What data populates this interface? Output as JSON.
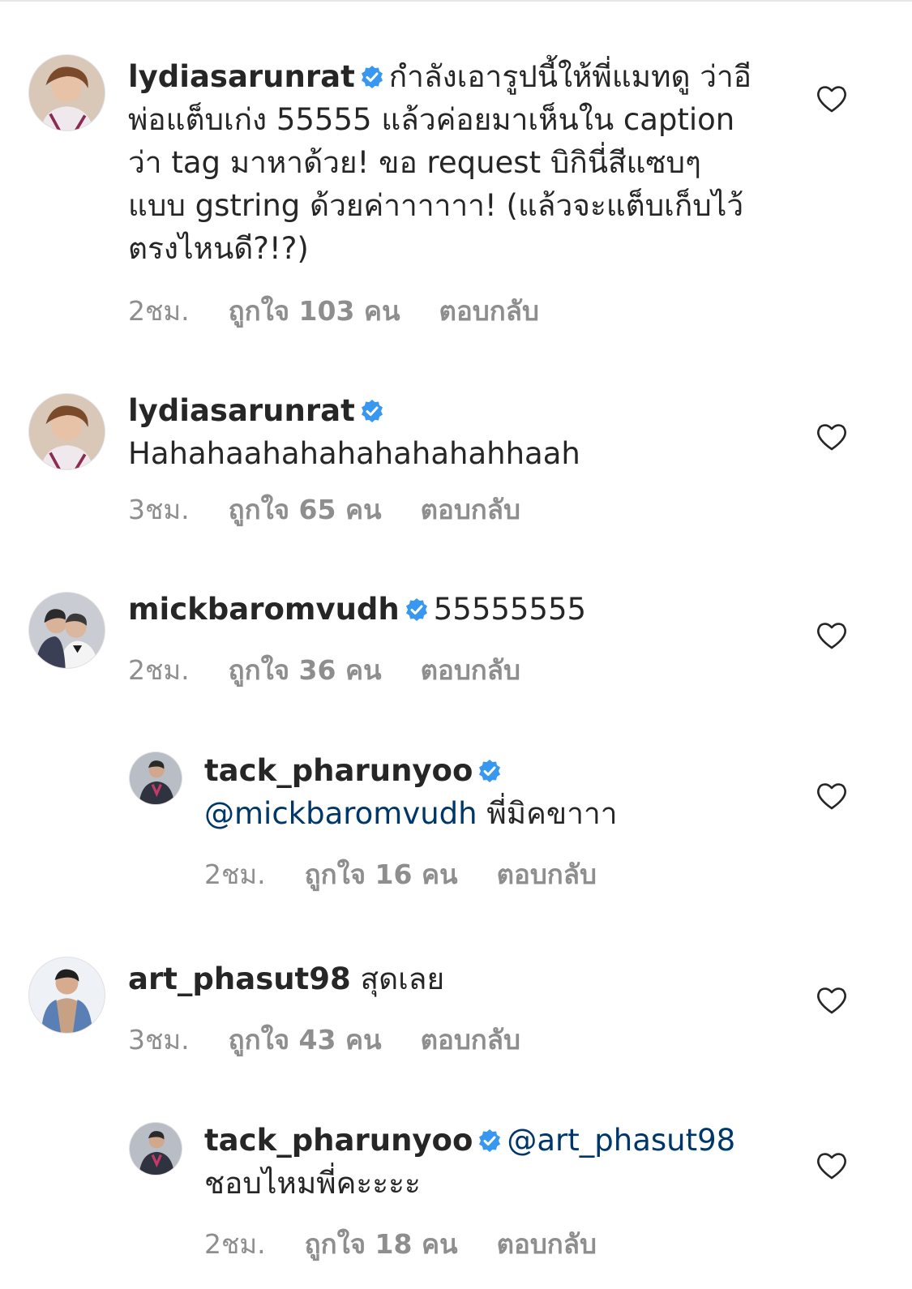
{
  "comments": [
    {
      "username": "lydiasarunrat",
      "verified": true,
      "mention": "",
      "text": "กำลังเอารูปนี้ให้พี่แมทดู ว่าอีพ่อแต็บเก่ง 55555 แล้วค่อยมาเห็นใน caption ว่า tag มาหาด้วย! ขอ request บิกินี่สีแซบๆแบบ gstring ด้วยค่าาาาาา! (แล้วจะแต็บเก็บไว้ตรงไหนดี?!?)",
      "time": "2ชม.",
      "likes": "ถูกใจ 103 คน",
      "reply_label": "ตอบกลับ",
      "avatar_icon": "avatar-photo"
    },
    {
      "username": "lydiasarunrat",
      "verified": true,
      "mention": "",
      "text": "Hahahaahahahahahahahhaah",
      "time": "3ชม.",
      "likes": "ถูกใจ 65 คน",
      "reply_label": "ตอบกลับ",
      "avatar_icon": "avatar-photo"
    },
    {
      "username": "mickbaromvudh",
      "verified": true,
      "mention": "",
      "text": "55555555",
      "time": "2ชม.",
      "likes": "ถูกใจ 36 คน",
      "reply_label": "ตอบกลับ",
      "avatar_icon": "avatar-photo"
    },
    {
      "username": "tack_pharunyoo",
      "verified": true,
      "mention": "@mickbaromvudh",
      "text": "พี่มิคขาาา",
      "time": "2ชม.",
      "likes": "ถูกใจ 16 คน",
      "reply_label": "ตอบกลับ",
      "avatar_icon": "avatar-photo"
    },
    {
      "username": "art_phasut98",
      "verified": false,
      "mention": "",
      "text": "สุดเลย",
      "time": "3ชม.",
      "likes": "ถูกใจ 43 คน",
      "reply_label": "ตอบกลับ",
      "avatar_icon": "avatar-photo"
    },
    {
      "username": "tack_pharunyoo",
      "verified": true,
      "mention": "@art_phasut98",
      "text": "ชอบไหมพี่คะะะะ",
      "time": "2ชม.",
      "likes": "ถูกใจ 18 คน",
      "reply_label": "ตอบกลับ",
      "avatar_icon": "avatar-photo"
    }
  ],
  "colors": {
    "verified_badge": "#3897f0",
    "mention": "#00376b",
    "meta_text": "#8e8e8e",
    "primary_text": "#262626"
  },
  "icons": {
    "verified": "verified-badge-icon",
    "like": "heart-outline-icon"
  }
}
